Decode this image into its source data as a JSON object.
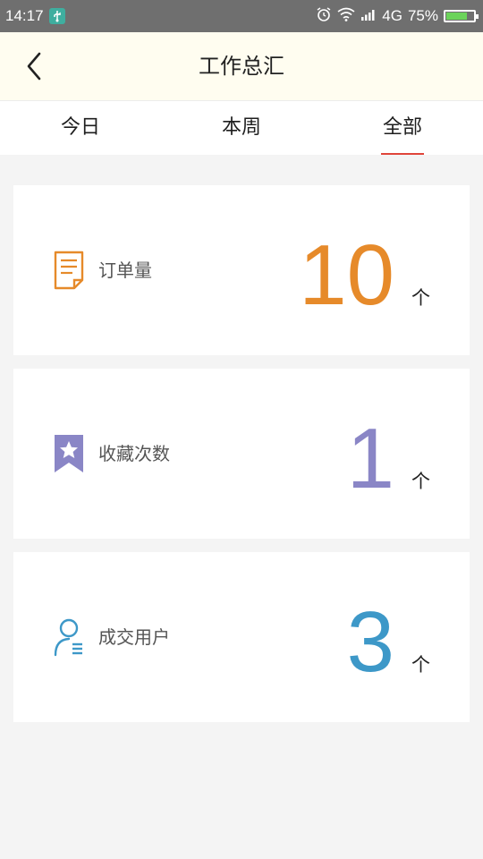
{
  "status_bar": {
    "time": "14:17",
    "network": "4G",
    "battery_text": "75%",
    "battery_level": 0.75
  },
  "header": {
    "title": "工作总汇",
    "back_icon": "chevron-left-icon"
  },
  "tabs": [
    {
      "label": "今日",
      "active": false
    },
    {
      "label": "本周",
      "active": false
    },
    {
      "label": "全部",
      "active": true
    }
  ],
  "cards": [
    {
      "label": "订单量",
      "value": "10",
      "unit": "个",
      "icon": "document-icon",
      "color": "#e68a2a"
    },
    {
      "label": "收藏次数",
      "value": "1",
      "unit": "个",
      "icon": "bookmark-star-icon",
      "color": "#8a86c6"
    },
    {
      "label": "成交用户",
      "value": "3",
      "unit": "个",
      "icon": "user-list-icon",
      "color": "#3d98c8"
    }
  ],
  "colors": {
    "tab_indicator": "#e0453a",
    "header_bg": "#fffdf0",
    "status_bar_bg": "#6f6f6f"
  }
}
